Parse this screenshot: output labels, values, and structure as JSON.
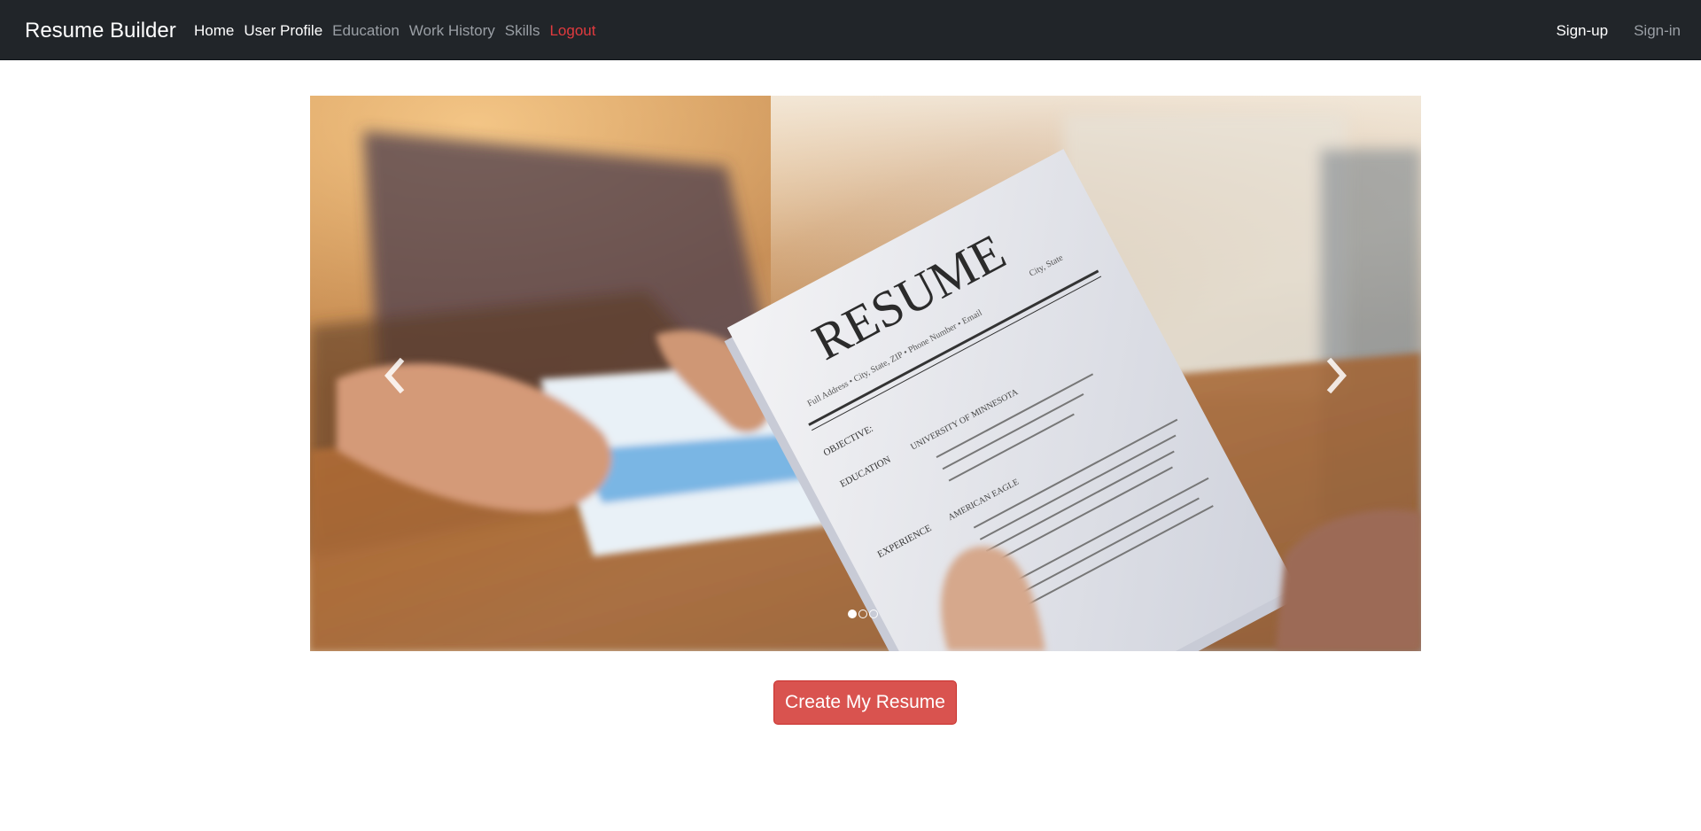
{
  "navbar": {
    "brand": "Resume Builder",
    "left_items": [
      {
        "label": "Home"
      },
      {
        "label": "User Profile"
      },
      {
        "label": "Education"
      },
      {
        "label": "Work History"
      },
      {
        "label": "Skills"
      },
      {
        "label": "Logout"
      }
    ],
    "right_items": [
      {
        "label": "Sign-up"
      },
      {
        "label": "Sign-in"
      }
    ],
    "colors": {
      "background": "#212529",
      "active": "#ffffff",
      "muted": "#9a9fa5",
      "logout": "#e03a3e"
    }
  },
  "carousel": {
    "slide_count": 3,
    "active_slide": 1,
    "slide_image": {
      "heading": "RESUME",
      "contact_line": "Full Address • City, State, ZIP • Phone Number • Email",
      "section_objective": "OBJECTIVE:",
      "section_education": "EDUCATION",
      "school": "UNIVERSITY OF MINNESOTA",
      "section_experience": "EXPERIENCE",
      "employer": "AMERICAN EAGLE",
      "location": "City, State"
    },
    "prev_icon": "chevron-left-icon",
    "next_icon": "chevron-right-icon"
  },
  "cta": {
    "label": "Create My Resume",
    "color": "#d9534f"
  }
}
